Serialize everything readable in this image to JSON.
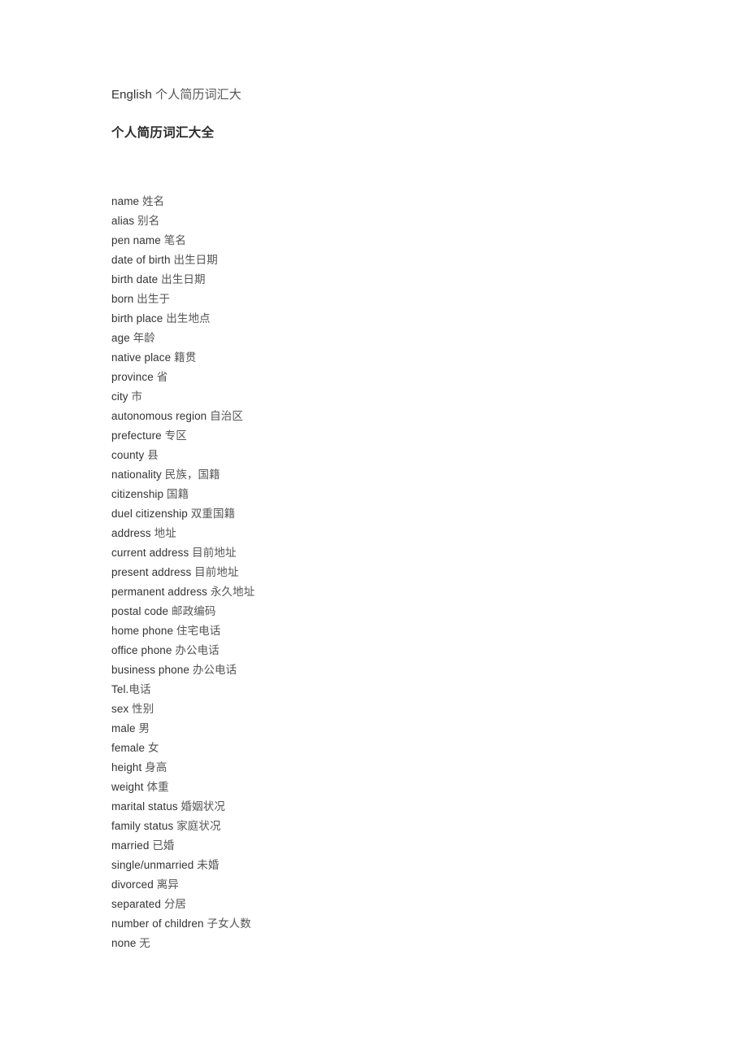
{
  "document": {
    "title_line": {
      "english": "English ",
      "chinese": "个人简历词汇大"
    },
    "heading": "个人简历词汇大全",
    "vocabulary": [
      {
        "term": "name",
        "sep": " ",
        "gloss": "姓名"
      },
      {
        "term": "alias",
        "sep": " ",
        "gloss": "别名"
      },
      {
        "term": "pen name",
        "sep": " ",
        "gloss": "笔名"
      },
      {
        "term": "date of birth",
        "sep": " ",
        "gloss": "出生日期"
      },
      {
        "term": "birth date",
        "sep": " ",
        "gloss": "出生日期"
      },
      {
        "term": "born",
        "sep": " ",
        "gloss": "出生于"
      },
      {
        "term": "birth place",
        "sep": " ",
        "gloss": "出生地点"
      },
      {
        "term": "age",
        "sep": " ",
        "gloss": "年龄"
      },
      {
        "term": "native place",
        "sep": " ",
        "gloss": "籍贯"
      },
      {
        "term": "province",
        "sep": " ",
        "gloss": "省"
      },
      {
        "term": "city",
        "sep": " ",
        "gloss": "市"
      },
      {
        "term": "autonomous region",
        "sep": " ",
        "gloss": "自治区"
      },
      {
        "term": "prefecture",
        "sep": " ",
        "gloss": "专区"
      },
      {
        "term": "county",
        "sep": " ",
        "gloss": "县"
      },
      {
        "term": "nationality",
        "sep": " ",
        "gloss": "民族，国籍"
      },
      {
        "term": "citizenship",
        "sep": " ",
        "gloss": "国籍"
      },
      {
        "term": "duel citizenship",
        "sep": " ",
        "gloss": "双重国籍"
      },
      {
        "term": "address",
        "sep": " ",
        "gloss": "地址"
      },
      {
        "term": "current address",
        "sep": " ",
        "gloss": "目前地址"
      },
      {
        "term": "present address",
        "sep": " ",
        "gloss": "目前地址"
      },
      {
        "term": "permanent address",
        "sep": " ",
        "gloss": "永久地址"
      },
      {
        "term": "postal code",
        "sep": " ",
        "gloss": "邮政编码"
      },
      {
        "term": "home phone",
        "sep": " ",
        "gloss": "住宅电话"
      },
      {
        "term": "office phone",
        "sep": " ",
        "gloss": "办公电话"
      },
      {
        "term": "business phone",
        "sep": " ",
        "gloss": "办公电话"
      },
      {
        "term": "Tel.",
        "sep": "",
        "gloss": "电话"
      },
      {
        "term": "sex",
        "sep": " ",
        "gloss": "性别"
      },
      {
        "term": "male",
        "sep": " ",
        "gloss": "男"
      },
      {
        "term": "female",
        "sep": " ",
        "gloss": "女"
      },
      {
        "term": "height",
        "sep": " ",
        "gloss": "身高"
      },
      {
        "term": "weight",
        "sep": " ",
        "gloss": "体重"
      },
      {
        "term": "marital status",
        "sep": " ",
        "gloss": "婚姻状况"
      },
      {
        "term": "family status",
        "sep": " ",
        "gloss": "家庭状况"
      },
      {
        "term": "married",
        "sep": " ",
        "gloss": "已婚"
      },
      {
        "term": "single/unmarried",
        "sep": " ",
        "gloss": "未婚"
      },
      {
        "term": "divorced",
        "sep": " ",
        "gloss": "离异"
      },
      {
        "term": "separated",
        "sep": " ",
        "gloss": "分居"
      },
      {
        "term": "number of children",
        "sep": " ",
        "gloss": "子女人数"
      },
      {
        "term": "none",
        "sep": " ",
        "gloss": "无"
      }
    ]
  }
}
